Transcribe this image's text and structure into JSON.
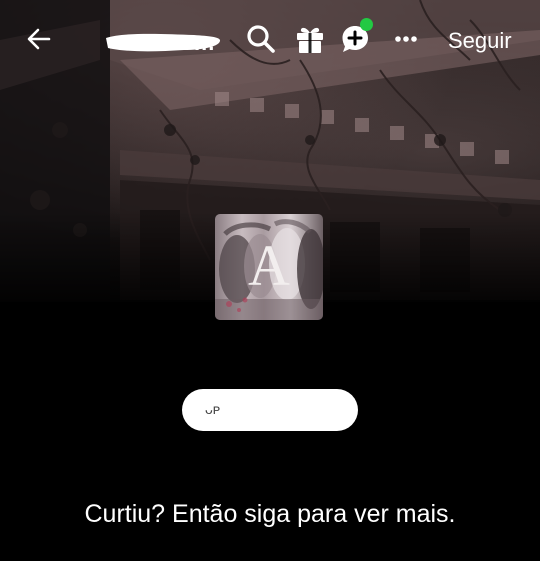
{
  "header": {
    "title_visible": "...",
    "follow_label": "Seguir",
    "icons": {
      "back": "arrow-left-icon",
      "search": "search-icon",
      "gift": "gift-icon",
      "chat": "chat-plus-icon",
      "more": "more-horizontal-icon"
    },
    "status_dot_color": "#22c943"
  },
  "profile": {
    "avatar_letter": "A",
    "name_fragment": "ᴗᴘ"
  },
  "prompt": {
    "text": "Curtiu? Então siga para ver mais."
  },
  "colors": {
    "background": "#000000",
    "text": "#ffffff",
    "pill": "#ffffff"
  }
}
